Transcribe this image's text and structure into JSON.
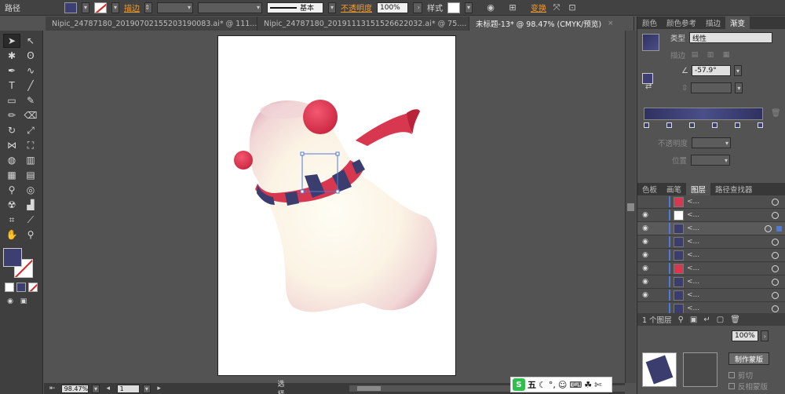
{
  "control_bar": {
    "object_type": "路径",
    "stroke_label": "描边",
    "stroke_style": "基本",
    "opacity_label": "不透明度",
    "opacity_value": "100%",
    "style_label": "样式",
    "transform_label": "变换"
  },
  "doc_tabs": [
    {
      "label": "Nipic_24787180_20190702155203190083.ai* @ 111...",
      "close": "×",
      "active": false
    },
    {
      "label": "Nipic_24787180_20191113151526622032.ai* @ 75....",
      "close": "×",
      "active": false
    },
    {
      "label": "未标题-13* @ 98.47% (CMYK/预览)",
      "close": "×",
      "active": true
    }
  ],
  "status_bar": {
    "zoom": "98.47%",
    "page": "1",
    "mode": "选择"
  },
  "gradient_panel": {
    "tabs": [
      "颜色",
      "颜色参考",
      "描边",
      "渐变"
    ],
    "type_label": "类型",
    "type_value": "线性",
    "stroke_label": "描边",
    "angle_value": "-57.9°",
    "opacity_label": "不透明度",
    "position_label": "位置"
  },
  "layers_panel": {
    "tabs": [
      "色板",
      "画笔",
      "图层",
      "路径查找器"
    ],
    "footer": "1 个图层",
    "rows": 9
  },
  "bottom_panel": {
    "opacity_value": "100%",
    "mask_button": "制作蒙版",
    "clip_label": "剪切",
    "invert_label": "反相蒙版"
  },
  "taskbar": {
    "ime": "五"
  },
  "colors": {
    "fill": "#3d3f73",
    "scarf_red": "#d8384f",
    "scarf_navy": "#3b3d6e",
    "accent": "#f29b2f"
  },
  "icons": [
    "selection-tool-icon",
    "direct-selection-icon",
    "magic-wand-icon",
    "lasso-icon",
    "pen-icon",
    "curvature-icon",
    "type-icon",
    "line-icon",
    "rectangle-icon",
    "paintbrush-icon",
    "pencil-icon",
    "eraser-icon",
    "rotate-icon",
    "scale-icon",
    "width-icon",
    "free-transform-icon",
    "shape-builder-icon",
    "perspective-icon",
    "mesh-icon",
    "gradient-icon",
    "eyedropper-icon",
    "blend-icon",
    "symbol-sprayer-icon",
    "column-graph-icon",
    "artboard-icon",
    "slice-icon",
    "hand-icon",
    "zoom-icon"
  ]
}
